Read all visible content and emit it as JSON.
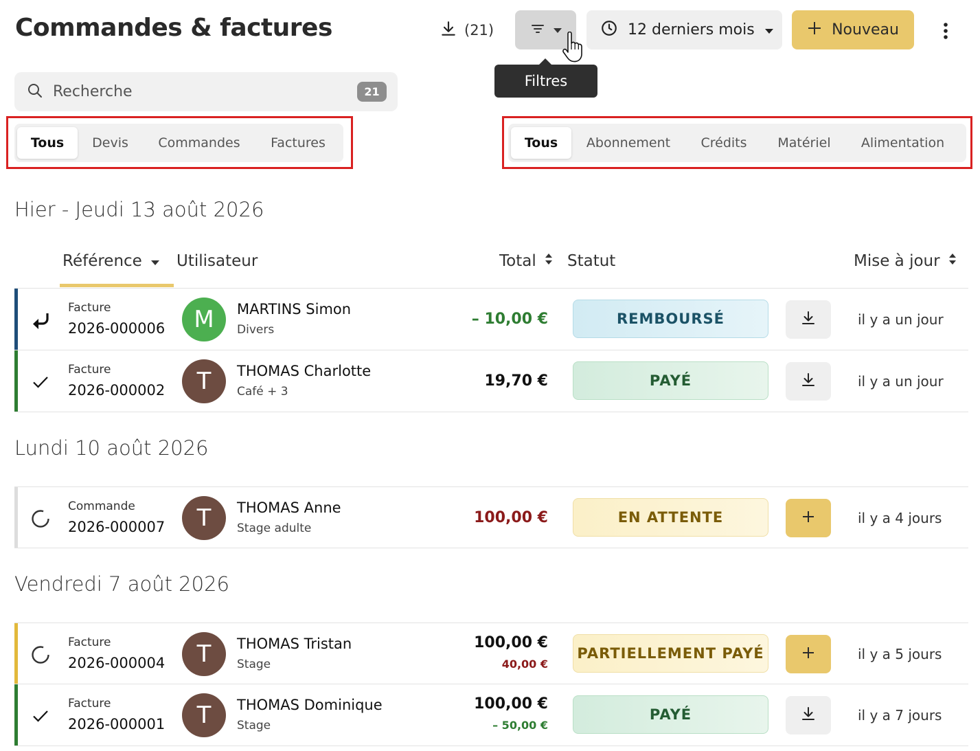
{
  "header": {
    "title": "Commandes & factures",
    "export_count": "(21)",
    "filter_tooltip": "Filtres",
    "period_label": "12 derniers mois",
    "new_label": "Nouveau"
  },
  "search": {
    "placeholder": "Recherche",
    "count": "21"
  },
  "type_tabs": [
    {
      "label": "Tous",
      "active": true
    },
    {
      "label": "Devis",
      "active": false
    },
    {
      "label": "Commandes",
      "active": false
    },
    {
      "label": "Factures",
      "active": false
    }
  ],
  "category_tabs": [
    {
      "label": "Tous",
      "active": true
    },
    {
      "label": "Abonnement",
      "active": false
    },
    {
      "label": "Crédits",
      "active": false
    },
    {
      "label": "Matériel",
      "active": false
    },
    {
      "label": "Alimentation",
      "active": false
    }
  ],
  "columns": {
    "reference": "Référence",
    "user": "Utilisateur",
    "total": "Total",
    "status": "Statut",
    "updated": "Mise à jour"
  },
  "groups": [
    {
      "title": "Hier - Jeudi 13 août 2026",
      "rows": [
        {
          "type": "Facture",
          "ref": "2026-000006",
          "initial": "M",
          "name": "MARTINS Simon",
          "sub": "Divers",
          "total": "– 10,00 €",
          "total_sub": "",
          "status": "REMBOURSÉ",
          "updated": "il y a un jour"
        },
        {
          "type": "Facture",
          "ref": "2026-000002",
          "initial": "T",
          "name": "THOMAS Charlotte",
          "sub": "Café + 3",
          "total": "19,70 €",
          "total_sub": "",
          "status": "PAYÉ",
          "updated": "il y a un jour"
        }
      ]
    },
    {
      "title": "Lundi 10 août 2026",
      "rows": [
        {
          "type": "Commande",
          "ref": "2026-000007",
          "initial": "T",
          "name": "THOMAS Anne",
          "sub": "Stage adulte",
          "total": "100,00 €",
          "total_sub": "",
          "status": "EN ATTENTE",
          "updated": "il y a 4 jours"
        }
      ]
    },
    {
      "title": "Vendredi 7 août 2026",
      "rows": [
        {
          "type": "Facture",
          "ref": "2026-000004",
          "initial": "T",
          "name": "THOMAS Tristan",
          "sub": "Stage",
          "total": "100,00 €",
          "total_sub": "40,00 €",
          "status": "PARTIELLEMENT PAYÉ",
          "updated": "il y a 5 jours"
        },
        {
          "type": "Facture",
          "ref": "2026-000001",
          "initial": "T",
          "name": "THOMAS Dominique",
          "sub": "Stage",
          "total": "100,00 €",
          "total_sub": "– 50,00 €",
          "status": "PAYÉ",
          "updated": "il y a 7 jours"
        }
      ]
    }
  ],
  "colors": {
    "accent": "#e9c86c",
    "avatar_green": "#4caf50",
    "avatar_brown": "#6d4c41",
    "refund_bar": "#1f4e79",
    "paid_bar": "#2e7d32",
    "pending_bar": "#dddddd",
    "partial_bar": "#e2b93b",
    "highlight_outline": "#d92121"
  }
}
